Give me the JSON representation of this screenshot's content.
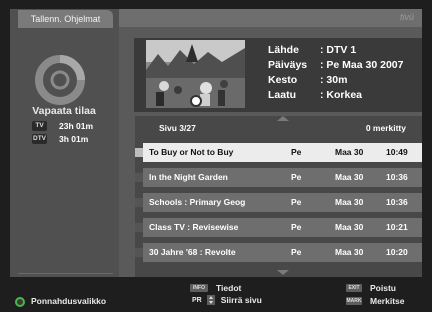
{
  "header": {
    "tab_title": "Tallenn. Ohjelmat",
    "brand": "tivü"
  },
  "storage": {
    "label": "Vapaata tilaa",
    "rows": [
      {
        "tag": "TV",
        "value": "23h 01m"
      },
      {
        "tag": "DTV",
        "value": "3h 01m"
      }
    ]
  },
  "details": {
    "labels": [
      "Lähde",
      "Päiväys",
      "Kesto",
      "Laatu"
    ],
    "values": [
      ": DTV 1",
      ": Pe Maa 30 2007",
      ": 30m",
      ": Korkea"
    ]
  },
  "list": {
    "page": "Sivu  3/27",
    "marked": "0 merkitty",
    "rows": [
      {
        "title": "To Buy or Not to Buy",
        "day": "Pe",
        "date": "Maa 30",
        "time": "10:49",
        "selected": true
      },
      {
        "title": "In the Night Garden",
        "day": "Pe",
        "date": "Maa 30",
        "time": "10:36",
        "selected": false
      },
      {
        "title": "Schools : Primary Geog",
        "day": "Pe",
        "date": "Maa 30",
        "time": "10:36",
        "selected": false
      },
      {
        "title": "Class TV : Revisewise",
        "day": "Pe",
        "date": "Maa 30",
        "time": "10:21",
        "selected": false
      },
      {
        "title": "30 Jahre '68 : Revolte",
        "day": "Pe",
        "date": "Maa 30",
        "time": "10:20",
        "selected": false
      }
    ]
  },
  "footer": {
    "popup_menu": "Ponnahdusvalikko",
    "info_key": "INFO",
    "info_label": "Tiedot",
    "pr_key": "PR",
    "page_label": "Siirrä sivu",
    "exit_key": "EXIT",
    "exit_label": "Poistu",
    "mark_key": "MARK",
    "mark_label": "Merkitse"
  },
  "colors": {
    "selected_row": "#ececec",
    "row": "#6e6e6e",
    "popup_ring": "#4bb84b"
  }
}
